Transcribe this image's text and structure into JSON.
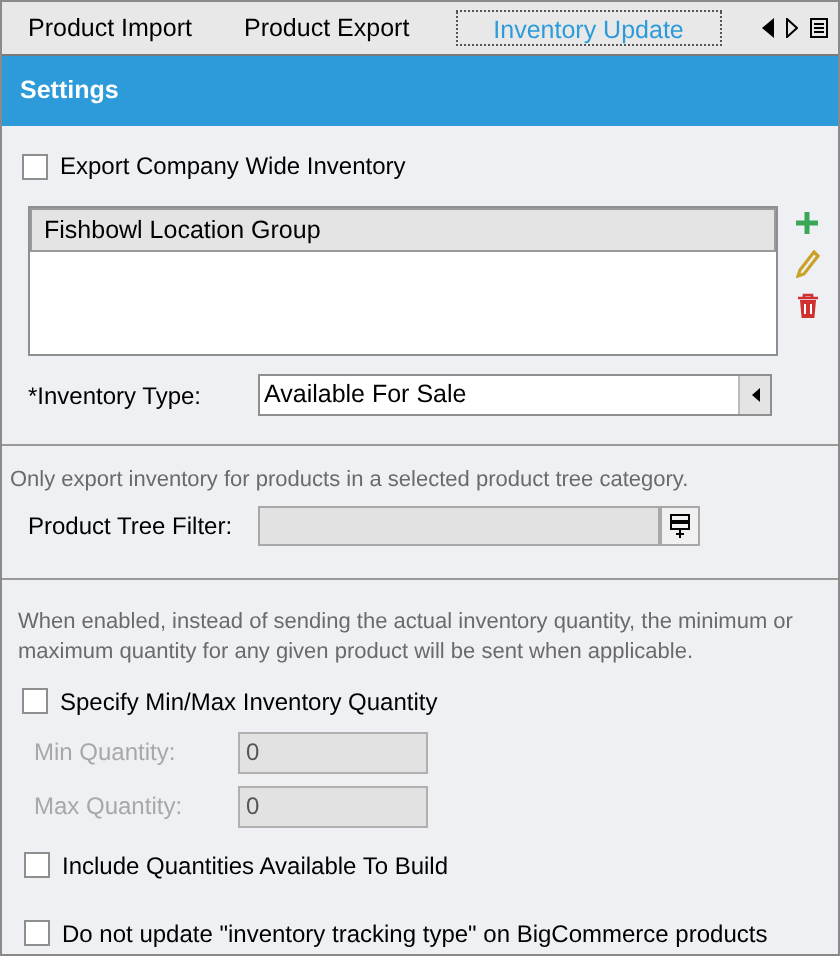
{
  "tabs": [
    {
      "label": "Product Import",
      "selected": false
    },
    {
      "label": "Product Export",
      "selected": false
    },
    {
      "label": "Inventory Update",
      "selected": true
    }
  ],
  "section": {
    "title": "Settings"
  },
  "export_company_wide": {
    "label": "Export Company Wide Inventory",
    "checked": false
  },
  "location_list": {
    "column": "Fishbowl Location Group"
  },
  "inventory_type": {
    "label": "*Inventory Type:",
    "value": "Available For Sale"
  },
  "tree_filter": {
    "note": "Only export inventory for products in a selected product tree category.",
    "label": "Product Tree Filter:",
    "disabled": true
  },
  "min_max": {
    "note": "When enabled, instead of sending the actual inventory quantity, the minimum or maximum quantity for any given product will be sent when applicable.",
    "checkbox": {
      "label": "Specify Min/Max Inventory Quantity",
      "checked": false
    },
    "fields": [
      {
        "label": "Min Quantity:",
        "value": "0",
        "disabled": true
      },
      {
        "label": "Max Quantity:",
        "value": "0",
        "disabled": true
      }
    ]
  },
  "options": [
    {
      "label": "Include Quantities Available To Build",
      "checked": false
    },
    {
      "label": "Do not update \"inventory tracking type\" on BigCommerce products",
      "checked": false
    }
  ]
}
